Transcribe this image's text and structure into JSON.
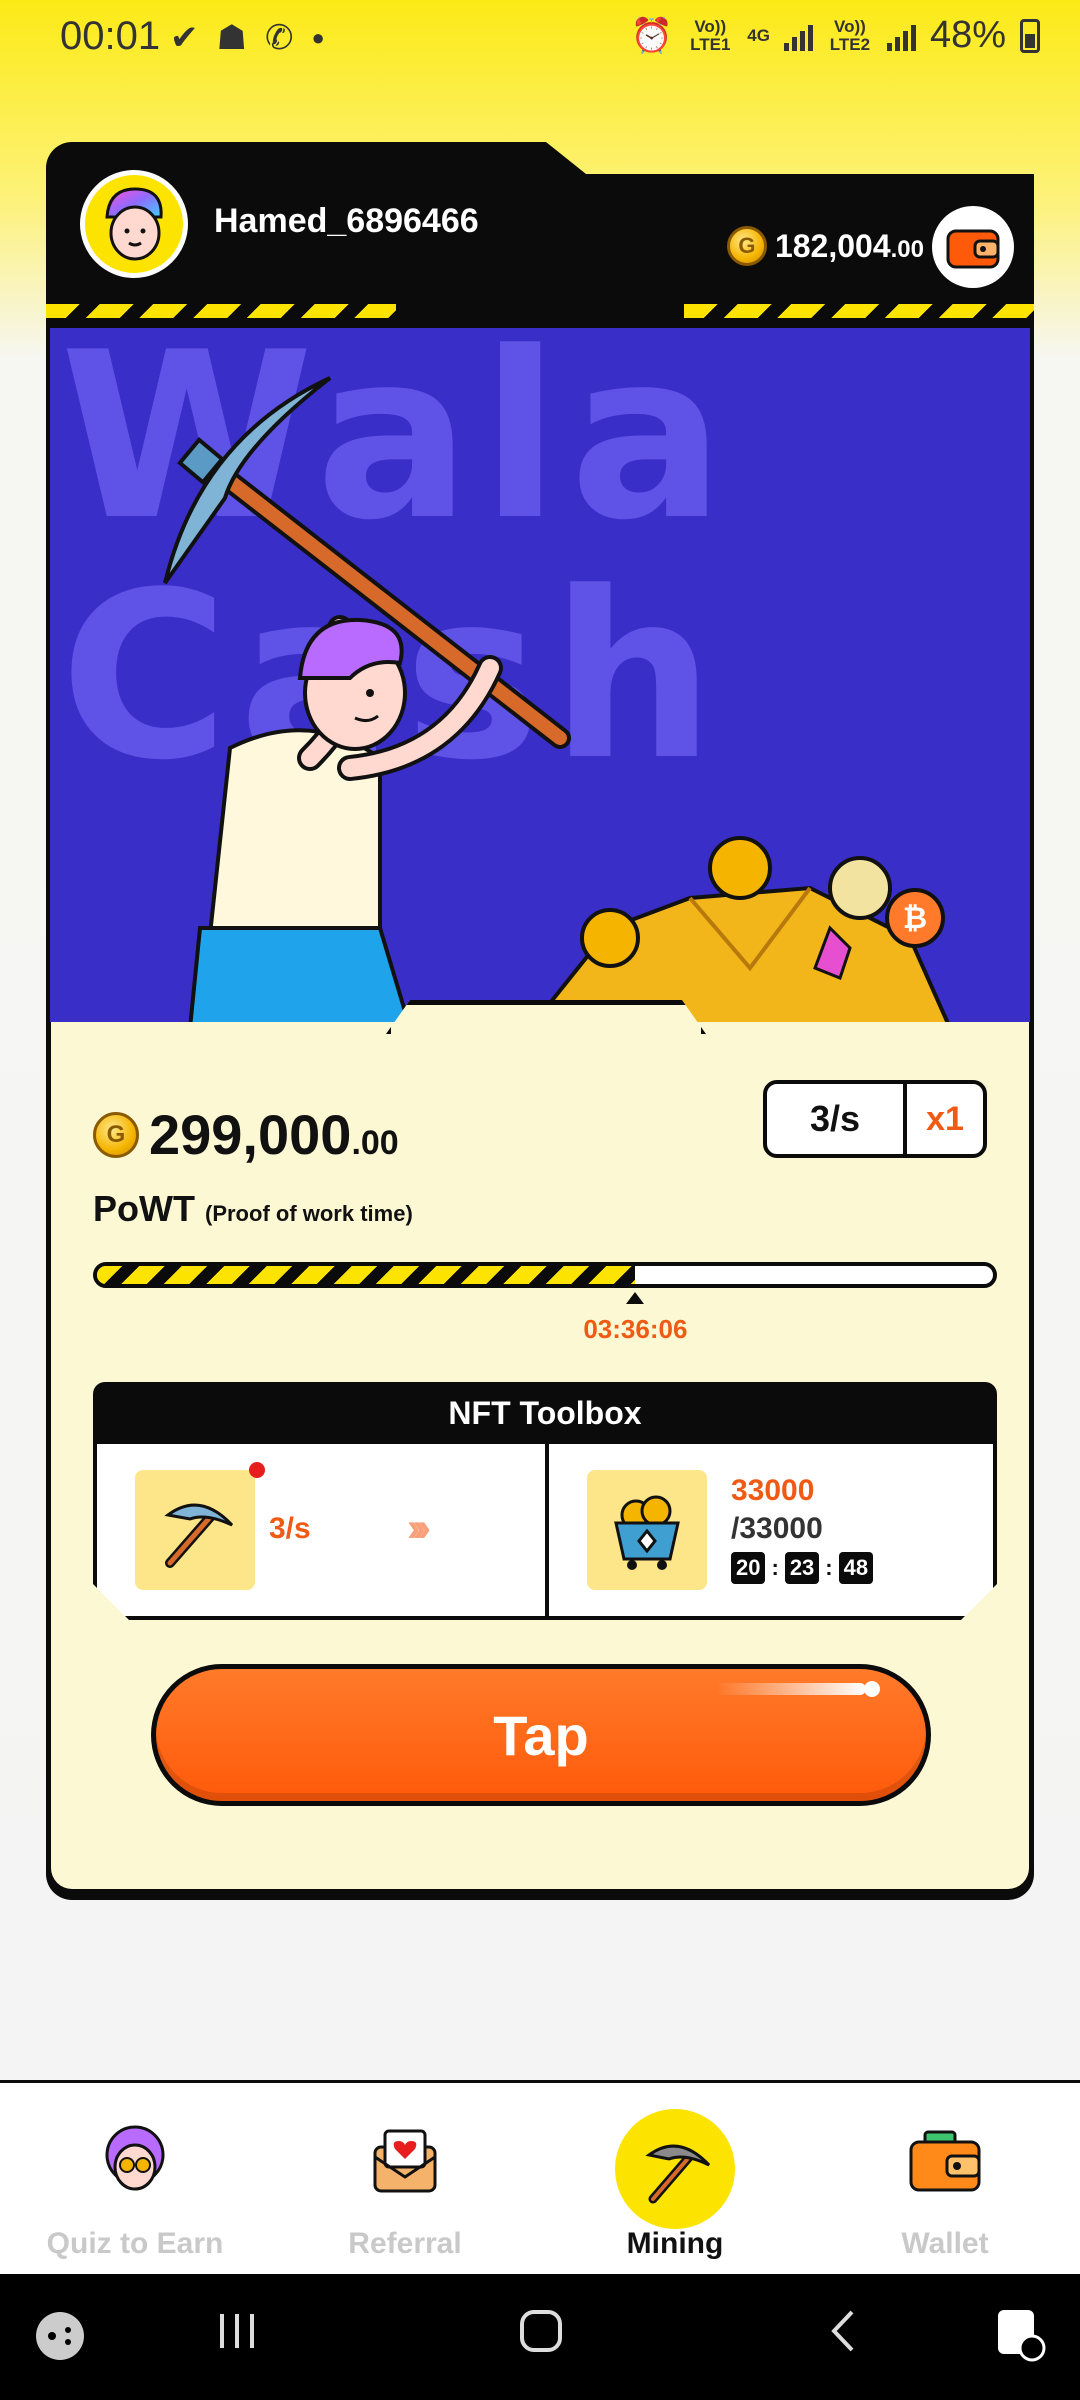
{
  "status_bar": {
    "time": "00:01",
    "sim1_label": "Vo)) LTE1",
    "net_label": "4G",
    "sim2_label": "Vo)) LTE2",
    "battery": "48%"
  },
  "header": {
    "username": "Hamed_6896466",
    "balance_int": "182,004",
    "balance_dec": ".00"
  },
  "hero": {
    "background_text": "Wala Cash"
  },
  "mining": {
    "balance_int": "299,000",
    "balance_dec": ".00",
    "rate": "3/s",
    "multiplier": "x1",
    "powt_title": "PoWT",
    "powt_subtitle": "(Proof of work time)",
    "progress_fraction": 0.6,
    "progress_time": "03:36:06"
  },
  "toolbox": {
    "title": "NFT Toolbox",
    "pickaxe_rate": "3/s",
    "cart_value": "33000",
    "cart_max": "/33000",
    "timer": [
      "20",
      "23",
      "48"
    ]
  },
  "tap_button": "Tap",
  "bottom_nav": [
    {
      "label": "Quiz to Earn",
      "icon": "quiz-avatar-icon",
      "active": false
    },
    {
      "label": "Referral",
      "icon": "heart-envelope-icon",
      "active": false
    },
    {
      "label": "Mining",
      "icon": "pickaxe-icon",
      "active": true
    },
    {
      "label": "Wallet",
      "icon": "wallet-icon",
      "active": false
    }
  ],
  "colors": {
    "accent_yellow": "#fde300",
    "accent_orange": "#f05a14",
    "hero_blue": "#3a2ec9"
  }
}
